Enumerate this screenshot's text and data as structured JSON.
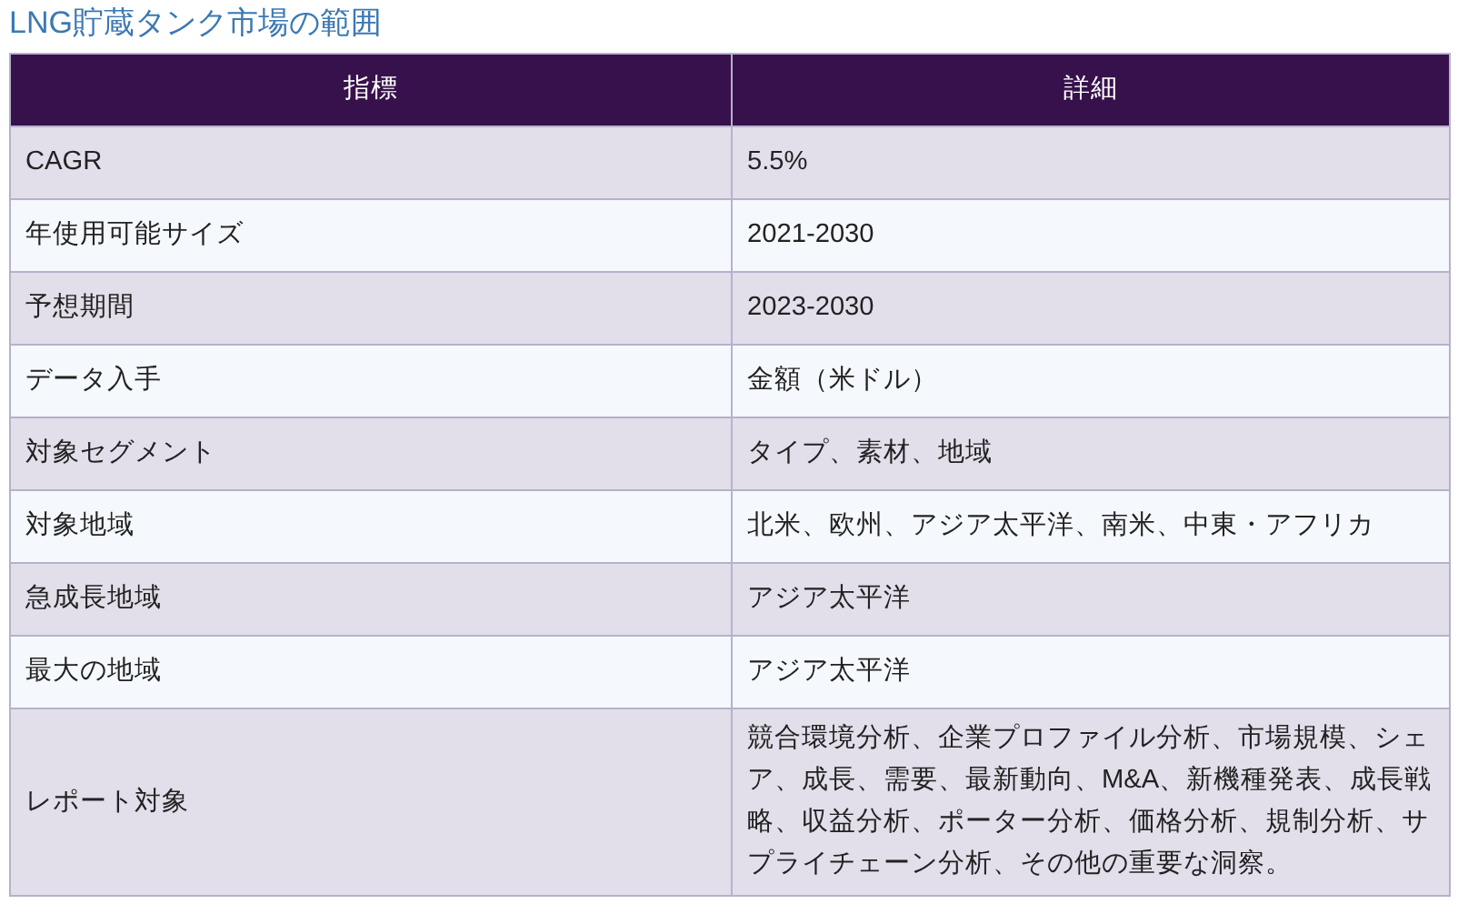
{
  "title": "LNG貯蔵タンク市場の範囲",
  "table": {
    "columns": [
      "指標",
      "詳細"
    ],
    "rows": [
      [
        "CAGR",
        "5.5%"
      ],
      [
        "年使用可能サイズ",
        "2021-2030"
      ],
      [
        "予想期間",
        "2023-2030"
      ],
      [
        "データ入手",
        "金額（米ドル）"
      ],
      [
        "対象セグメント",
        "タイプ、素材、地域"
      ],
      [
        "対象地域",
        "北米、欧州、アジア太平洋、南米、中東・アフリカ"
      ],
      [
        "急成長地域",
        "アジア太平洋"
      ],
      [
        "最大の地域",
        "アジア太平洋"
      ],
      [
        "レポート対象",
        "競合環境分析、企業プロファイル分析、市場規模、シェア、成長、需要、最新動向、M&A、新機種発表、成長戦略、収益分析、ポーター分析、価格分析、規制分析、サプライチェーン分析、その他の重要な洞察。"
      ]
    ]
  }
}
